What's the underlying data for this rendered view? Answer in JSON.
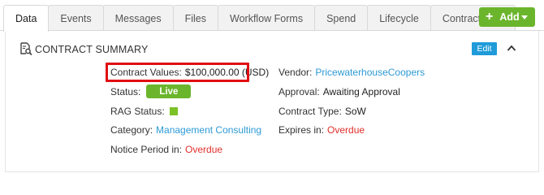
{
  "tabs": [
    {
      "label": "Data",
      "active": true
    },
    {
      "label": "Events"
    },
    {
      "label": "Messages"
    },
    {
      "label": "Files"
    },
    {
      "label": "Workflow Forms"
    },
    {
      "label": "Spend"
    },
    {
      "label": "Lifecycle"
    },
    {
      "label": "Contract Risk"
    }
  ],
  "add_button": {
    "label": "Add",
    "icon": "plus-icon",
    "dropdown_icon": "caret-down-icon",
    "color": "#6bb52c"
  },
  "section": {
    "title": "CONTRACT SUMMARY",
    "icon": "document-search-icon",
    "edit_label": "Edit",
    "edit_color": "#1f9bd9",
    "collapse_icon": "chevron-up-icon"
  },
  "fields": {
    "contract_values": {
      "label": "Contract Values:",
      "value": "$100,000.00 (USD)",
      "highlight_color": "#e00d12"
    },
    "status": {
      "label": "Status:",
      "value": "Live",
      "badge_color": "#6bb52c"
    },
    "rag_status": {
      "label": "RAG Status:",
      "color": "#7cc227"
    },
    "category": {
      "label": "Category:",
      "value": "Management Consulting"
    },
    "notice_period": {
      "label": "Notice Period in:",
      "value": "Overdue"
    },
    "vendor": {
      "label": "Vendor:",
      "value": "PricewaterhouseCoopers"
    },
    "approval": {
      "label": "Approval:",
      "value": "Awaiting Approval"
    },
    "contract_type": {
      "label": "Contract Type:",
      "value": "SoW"
    },
    "expires_in": {
      "label": "Expires in:",
      "value": "Overdue"
    }
  },
  "colors": {
    "link": "#2d9ad6",
    "overdue": "#e0302b"
  }
}
